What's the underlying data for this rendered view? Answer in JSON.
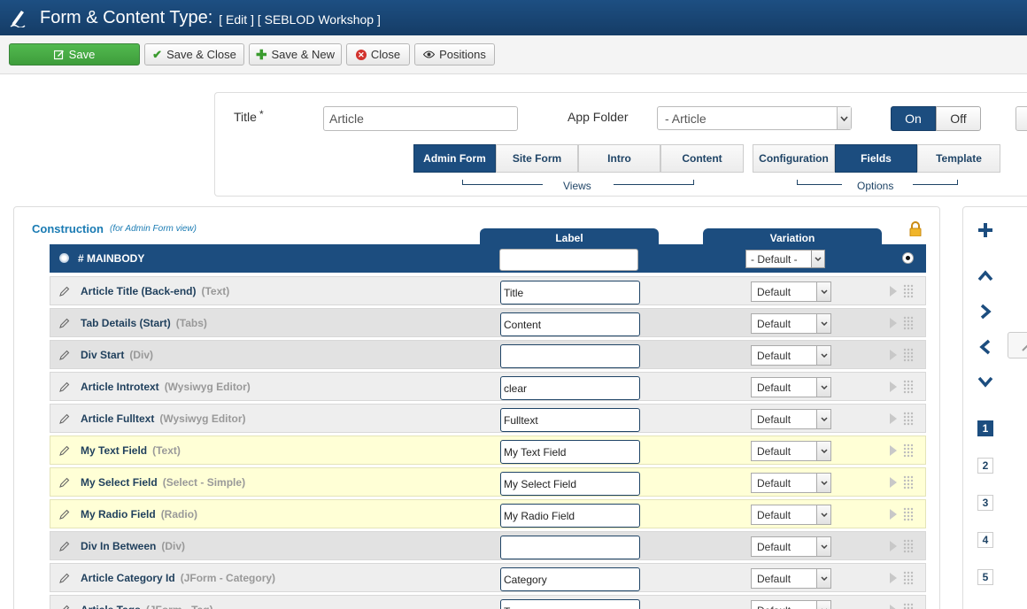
{
  "header": {
    "title": "Form & Content Type:",
    "subtitle": "[ Edit ] [ SEBLOD Workshop ]"
  },
  "toolbar": {
    "save": "Save",
    "save_close": "Save & Close",
    "save_new": "Save & New",
    "close": "Close",
    "positions": "Positions"
  },
  "settings": {
    "title_label": "Title",
    "title_required": "*",
    "title_value": "Article",
    "app_folder_label": "App Folder",
    "app_folder_value": "- Article",
    "toggle_on": "On",
    "toggle_off": "Off",
    "view_tabs": [
      "Admin Form",
      "Site Form",
      "Intro",
      "Content"
    ],
    "views_label": "Views",
    "option_tabs": [
      "Configuration",
      "Fields",
      "Template"
    ],
    "options_label": "Options",
    "active_view": "Admin Form",
    "active_option": "Fields"
  },
  "construction": {
    "title": "Construction",
    "subtitle": "(for Admin Form view)",
    "col_label": "Label",
    "col_variation": "Variation",
    "position_name": "# MAINBODY",
    "position_label_value": "",
    "position_variation": "- Default -",
    "fields": [
      {
        "name": "Article Title (Back-end)",
        "type": "(Text)",
        "label": "Title",
        "variation": "Default",
        "tone": "g"
      },
      {
        "name": "Tab Details (Start)",
        "type": "(Tabs)",
        "label": "Content",
        "variation": "Default",
        "tone": "d"
      },
      {
        "name": "Div Start",
        "type": "(Div)",
        "label": "",
        "variation": "Default",
        "tone": "d"
      },
      {
        "name": "Article Introtext",
        "type": "(Wysiwyg Editor)",
        "label": "clear",
        "variation": "Default",
        "tone": "g"
      },
      {
        "name": "Article Fulltext",
        "type": "(Wysiwyg Editor)",
        "label": "Fulltext",
        "variation": "Default",
        "tone": "g"
      },
      {
        "name": "My Text Field",
        "type": "(Text)",
        "label": "My Text Field",
        "variation": "Default",
        "tone": "y"
      },
      {
        "name": "My Select Field",
        "type": "(Select - Simple)",
        "label": "My Select Field",
        "variation": "Default",
        "tone": "y"
      },
      {
        "name": "My Radio Field",
        "type": "(Radio)",
        "label": "My Radio Field",
        "variation": "Default",
        "tone": "y"
      },
      {
        "name": "Div In Between",
        "type": "(Div)",
        "label": "",
        "variation": "Default",
        "tone": "d"
      },
      {
        "name": "Article Category Id",
        "type": "(JForm - Category)",
        "label": "Category",
        "variation": "Default",
        "tone": "g"
      },
      {
        "name": "Article Tags",
        "type": "(JForm - Tag)",
        "label": "Tags",
        "variation": "Default",
        "tone": "g"
      }
    ]
  },
  "sidebar": {
    "positions": [
      "1",
      "2",
      "3",
      "4",
      "5"
    ],
    "active_position": "1"
  },
  "colors": {
    "header_blue": "#1c4d7f",
    "save_green": "#44a541",
    "link_blue": "#1a7bb3",
    "highlight_yellow": "#ffffd6"
  }
}
